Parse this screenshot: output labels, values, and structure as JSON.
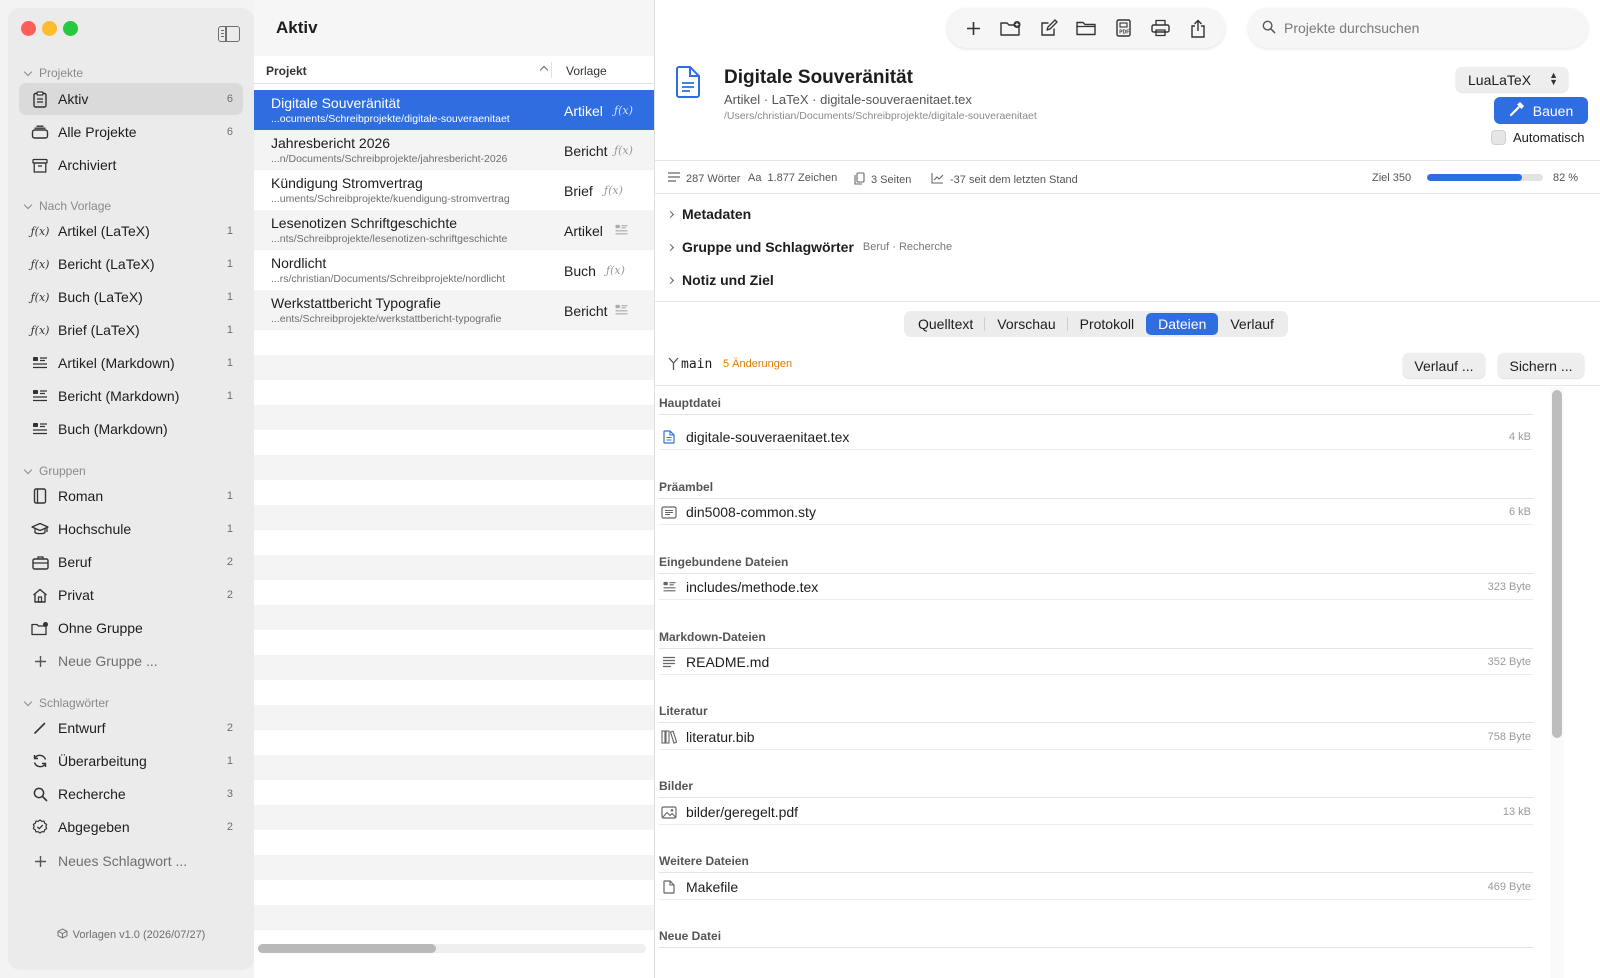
{
  "sidebar": {
    "sections": {
      "projekte": "Projekte",
      "vorlage": "Nach Vorlage",
      "gruppen": "Gruppen",
      "tags": "Schlagwörter"
    },
    "projekte": [
      {
        "label": "Aktiv",
        "count": "6",
        "icon": "clipboard-icon"
      },
      {
        "label": "Alle Projekte",
        "count": "6",
        "icon": "stack-icon"
      },
      {
        "label": "Archiviert",
        "count": "",
        "icon": "archive-icon"
      }
    ],
    "vorlagen": [
      {
        "label": "Artikel (LaTeX)",
        "count": "1",
        "icon": "function-icon"
      },
      {
        "label": "Bericht (LaTeX)",
        "count": "1",
        "icon": "function-icon"
      },
      {
        "label": "Buch (LaTeX)",
        "count": "1",
        "icon": "function-icon"
      },
      {
        "label": "Brief (LaTeX)",
        "count": "1",
        "icon": "function-icon"
      },
      {
        "label": "Artikel (Markdown)",
        "count": "1",
        "icon": "text-list-icon"
      },
      {
        "label": "Bericht (Markdown)",
        "count": "1",
        "icon": "text-list-icon"
      },
      {
        "label": "Buch (Markdown)",
        "count": "",
        "icon": "text-list-icon"
      }
    ],
    "gruppen": [
      {
        "label": "Roman",
        "count": "1",
        "icon": "book-icon"
      },
      {
        "label": "Hochschule",
        "count": "1",
        "icon": "graduation-cap-icon"
      },
      {
        "label": "Beruf",
        "count": "2",
        "icon": "briefcase-icon"
      },
      {
        "label": "Privat",
        "count": "2",
        "icon": "house-icon"
      },
      {
        "label": "Ohne Gruppe",
        "count": "",
        "icon": "folder-badge-icon"
      }
    ],
    "new_group": "Neue Gruppe ...",
    "tags": [
      {
        "label": "Entwurf",
        "count": "2",
        "icon": "pencil-icon"
      },
      {
        "label": "Überarbeitung",
        "count": "1",
        "icon": "refresh-icon"
      },
      {
        "label": "Recherche",
        "count": "3",
        "icon": "magnifier-icon"
      },
      {
        "label": "Abgegeben",
        "count": "2",
        "icon": "check-seal-icon"
      }
    ],
    "new_tag": "Neues Schlagwort ...",
    "footer": "Vorlagen v1.0 (2026/07/27)"
  },
  "list": {
    "title": "Aktiv",
    "col_project": "Projekt",
    "col_template": "Vorlage",
    "rows": [
      {
        "name": "Digitale Souveränität",
        "path": "...ocuments/Schreibprojekte/digitale-souveraenitaet",
        "template": "Artikel",
        "icon": "function-icon"
      },
      {
        "name": "Jahresbericht 2026",
        "path": "...n/Documents/Schreibprojekte/jahresbericht-2026",
        "template": "Bericht",
        "icon": "function-icon"
      },
      {
        "name": "Kündigung Stromvertrag",
        "path": "...uments/Schreibprojekte/kuendigung-stromvertrag",
        "template": "Brief",
        "icon": "function-icon"
      },
      {
        "name": "Lesenotizen Schriftgeschichte",
        "path": "...nts/Schreibprojekte/lesenotizen-schriftgeschichte",
        "template": "Artikel",
        "icon": "text-list-icon"
      },
      {
        "name": "Nordlicht",
        "path": "...rs/christian/Documents/Schreibprojekte/nordlicht",
        "template": "Buch",
        "icon": "function-icon"
      },
      {
        "name": "Werkstattbericht Typografie",
        "path": "...ents/Schreibprojekte/werkstattbericht-typografie",
        "template": "Bericht",
        "icon": "text-list-icon"
      }
    ]
  },
  "search": {
    "placeholder": "Projekte durchsuchen"
  },
  "detail": {
    "title": "Digitale Souveränität",
    "subtitle": "Artikel · LaTeX · digitale-souveraenitaet.tex",
    "path": "/Users/christian/Documents/Schreibprojekte/digitale-souveraenitaet",
    "engine": "LuaLaTeX",
    "build_label": "Bauen",
    "auto_label": "Automatisch",
    "stats": {
      "words": "287 Wörter",
      "chars_prefix": "Aa",
      "chars": "1.877 Zeichen",
      "pages": "3 Seiten",
      "delta": "-37 seit dem letzten Stand",
      "goal": "Ziel 350",
      "percent_label": "82 %",
      "progress": 0.82
    },
    "sections": {
      "meta": "Metadaten",
      "group": "Gruppe und Schlagwörter",
      "group_tags": "Beruf · Recherche",
      "note": "Notiz und Ziel"
    },
    "tabs": [
      "Quelltext",
      "Vorschau",
      "Protokoll",
      "Dateien",
      "Verlauf"
    ],
    "active_tab": "Dateien",
    "branch": "main",
    "changes": "5 Änderungen",
    "history_btn": "Verlauf ...",
    "save_btn": "Sichern ...",
    "files": [
      {
        "section": "Hauptdatei",
        "name": "digitale-souveraenitaet.tex",
        "size": "4 kB",
        "icon": "document-icon"
      },
      {
        "section": "Präambel",
        "name": "din5008-common.sty",
        "size": "6 kB",
        "icon": "text-box-icon"
      },
      {
        "section": "Eingebundene Dateien",
        "name": "includes/methode.tex",
        "size": "323 Byte",
        "icon": "text-list-icon"
      },
      {
        "section": "Markdown-Dateien",
        "name": "README.md",
        "size": "352 Byte",
        "icon": "lines-icon"
      },
      {
        "section": "Literatur",
        "name": "literatur.bib",
        "size": "758 Byte",
        "icon": "books-icon"
      },
      {
        "section": "Bilder",
        "name": "bilder/geregelt.pdf",
        "size": "13 kB",
        "icon": "photo-icon"
      },
      {
        "section": "Weitere Dateien",
        "name": "Makefile",
        "size": "469 Byte",
        "icon": "blank-document-icon"
      }
    ],
    "new_file_section": "Neue Datei"
  }
}
